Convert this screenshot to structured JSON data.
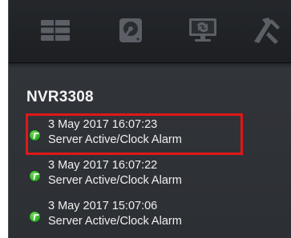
{
  "toolbar": {
    "buttons": [
      {
        "icon": "server-list-icon"
      },
      {
        "icon": "hard-disk-icon"
      },
      {
        "icon": "monitor-sync-icon"
      },
      {
        "icon": "tools-icon"
      }
    ]
  },
  "device": {
    "name": "NVR3308"
  },
  "events": [
    {
      "time": "3 May 2017 16:07:23",
      "message": "Server Active/Clock Alarm",
      "status_color": "#33b02a"
    },
    {
      "time": "3 May 2017 16:07:22",
      "message": "Server Active/Clock Alarm",
      "status_color": "#33b02a"
    },
    {
      "time": "3 May 2017 15:07:06",
      "message": "Server Active/Clock Alarm",
      "status_color": "#33b02a"
    }
  ],
  "highlight_color": "#e01818"
}
